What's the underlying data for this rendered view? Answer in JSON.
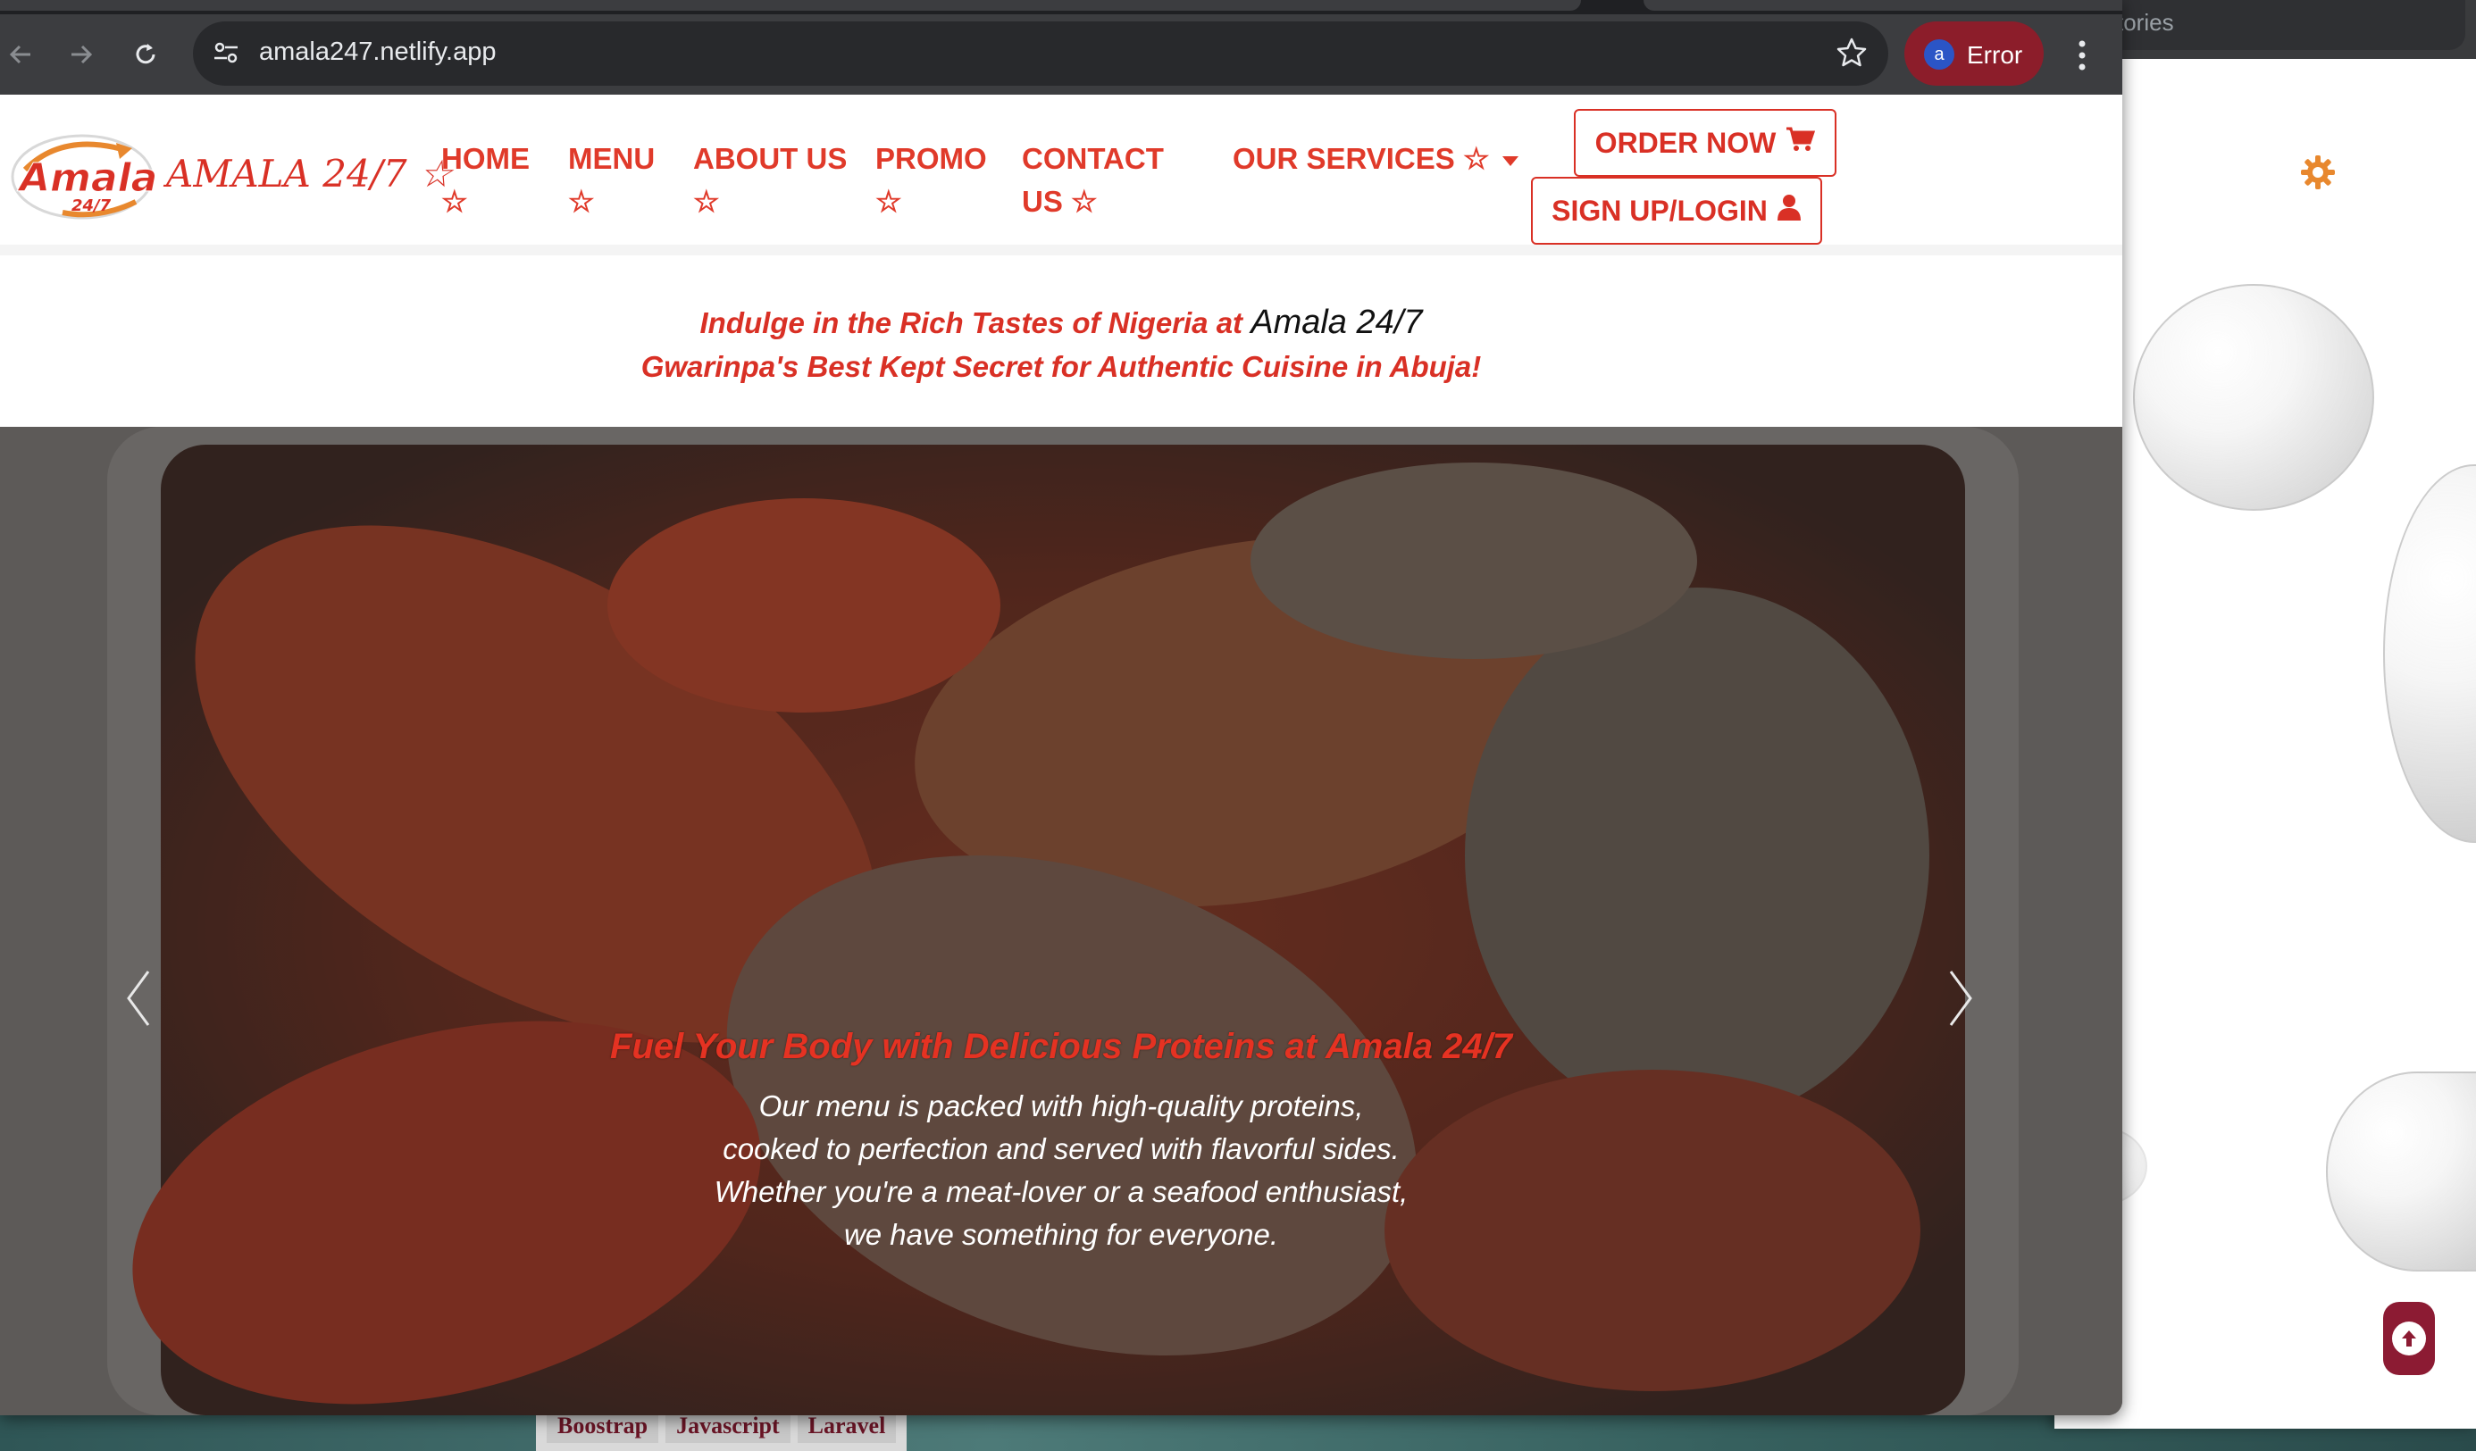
{
  "background_window": {
    "tab_fragment": "tories",
    "bottom_tags": [
      "Boostrap",
      "Javascript",
      "Laravel"
    ]
  },
  "browser": {
    "url": "amala247.netlify.app",
    "profile_initial": "a",
    "profile_status": "Error"
  },
  "site": {
    "brand": "AMALA 24/7 ☆",
    "nav": [
      {
        "line1": "HOME",
        "line2": "☆"
      },
      {
        "line1": "MENU",
        "line2": "☆"
      },
      {
        "line1": "ABOUT US",
        "line2": "☆"
      },
      {
        "line1": "PROMO",
        "line2": "☆"
      },
      {
        "line1": "CONTACT",
        "line2": "US ☆"
      },
      {
        "line1": "OUR SERVICES ☆",
        "line2": ""
      }
    ],
    "order_button": "ORDER NOW",
    "login_button": "SIGN UP/LOGIN"
  },
  "tagline": {
    "line1_prefix": "Indulge in the Rich Tastes of Nigeria at ",
    "line1_brand": "Amala 24/7",
    "line2": "Gwarinpa's Best Kept Secret for Authentic Cuisine in Abuja!"
  },
  "hero": {
    "caption_title": "Fuel Your Body with Delicious Proteins at Amala 24/7",
    "caption_lines": [
      "Our menu is packed with high-quality proteins,",
      "cooked to perfection and served with flavorful sides.",
      "Whether you're a meat-lover or a seafood enthusiast,",
      "we have something for everyone."
    ]
  },
  "colors": {
    "brand_red": "#d93025",
    "chrome_dark": "#3c3d40",
    "profile_chip": "#8c1d2a",
    "scroll_button": "#8c1b33"
  },
  "icons": {
    "nav_caret": "caret-down-icon",
    "order": "cart-icon",
    "login": "user-icon",
    "theme": "gear-icon",
    "scroll": "arrow-up-circle-icon"
  }
}
